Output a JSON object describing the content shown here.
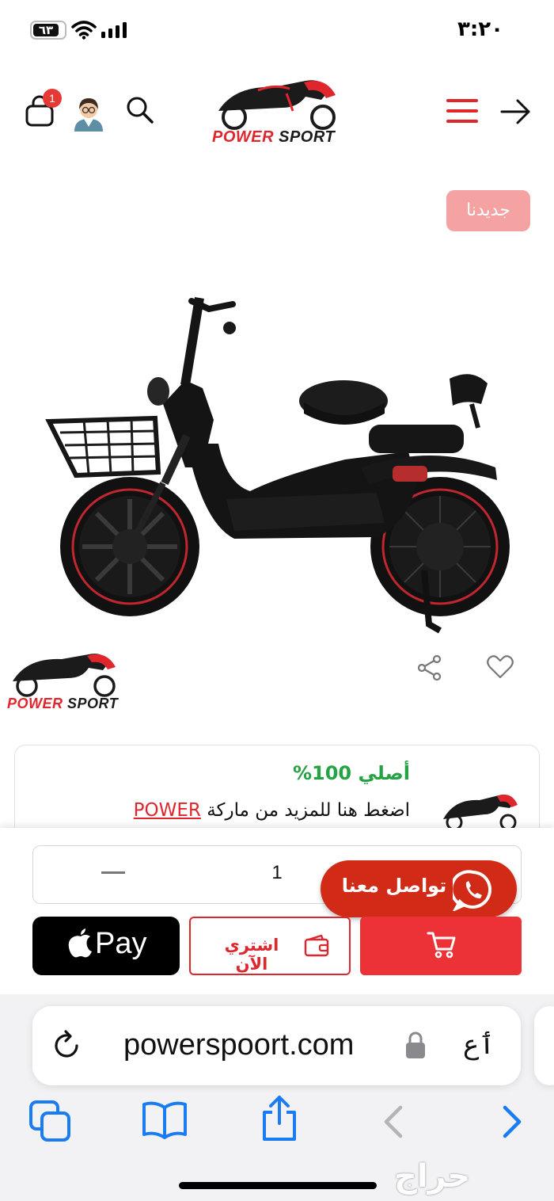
{
  "status_bar": {
    "time": "٣:٢٠",
    "battery": "٦٣"
  },
  "header": {
    "cart_count": "1",
    "logo_text": "POWER SPORT"
  },
  "product": {
    "new_tag": "جديدنا",
    "brand_logo_text": "POWER SPORT"
  },
  "info_card": {
    "original": "أصلي 100%",
    "more_prefix": "اضغط هنا للمزيد من ماركة",
    "brand": "POWER"
  },
  "purchase": {
    "quantity": "1",
    "whatsapp_label": "تواصل معنا",
    "apple_pay_label": "Pay",
    "buy_now_label": "اشتري الآن"
  },
  "browser": {
    "url": "powerspoort.com",
    "text_size": "ٲع",
    "watermark": "حراج"
  },
  "colors": {
    "brand_red": "#e0262d",
    "new_tag_bg": "#f4a2a2",
    "success_green": "#25a244",
    "whatsapp_btn": "#d12a16",
    "safari_blue": "#1a7cf3"
  },
  "icons": [
    "battery-icon",
    "wifi-icon",
    "signal-icon",
    "cart-icon",
    "avatar-icon",
    "search-icon",
    "menu-icon",
    "back-arrow-icon",
    "share-icon",
    "heart-icon",
    "whatsapp-icon",
    "apple-icon",
    "wallet-icon",
    "add-to-cart-icon",
    "reload-icon",
    "lock-icon",
    "tabs-icon",
    "bookmarks-icon",
    "share-sheet-icon",
    "chevron-left-icon",
    "chevron-right-icon"
  ]
}
